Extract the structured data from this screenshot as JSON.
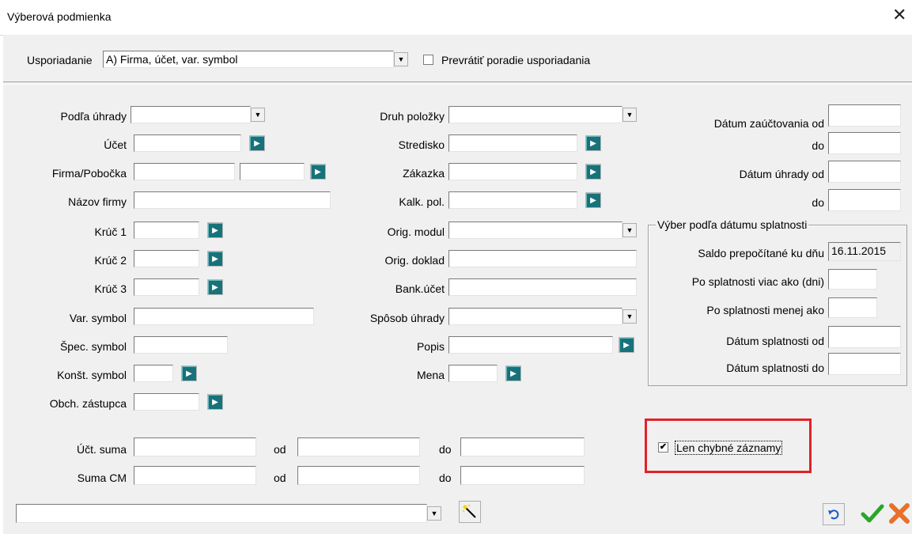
{
  "window": {
    "title": "Výberová podmienka",
    "close": "✕"
  },
  "sort": {
    "label": "Usporiadanie",
    "value": "A) Firma, účet, var. symbol",
    "reverse_label": "Prevrátiť poradie usporiadania",
    "reverse_checked": false
  },
  "left": {
    "podla_uhrady": "Podľa úhrady",
    "ucet": "Účet",
    "firma": "Firma/Pobočka",
    "nazov": "Názov firmy",
    "kluc1": "Krúč 1",
    "kluc2": "Krúč 2",
    "kluc3": "Krúč 3",
    "var_symbol": "Var. symbol",
    "spec_symbol": "Špec. symbol",
    "konst_symbol": "Konšt. symbol",
    "obch_zastupca": "Obch. zástupca"
  },
  "middle": {
    "druh": "Druh položky",
    "stredisko": "Stredisko",
    "zakazka": "Zákazka",
    "kalk": "Kalk. pol.",
    "orig_modul": "Orig. modul",
    "orig_doklad": "Orig. doklad",
    "bank": "Bank.účet",
    "sposob": "Spôsob úhrady",
    "popis": "Popis",
    "mena": "Mena"
  },
  "right": {
    "datum_zauct_od": "Dátum zaúčtovania od",
    "do1": "do",
    "datum_uhrady_od": "Dátum úhrady od",
    "do2": "do",
    "group_title": "Výber podľa dátumu splatnosti",
    "saldo": "Saldo prepočítané ku dňu",
    "saldo_value": "16.11.2015",
    "po_viac": "Po splatnosti viac ako (dni)",
    "po_menej": "Po splatnosti menej ako",
    "dat_spl_od": "Dátum splatnosti od",
    "dat_spl_do": "Dátum splatnosti do"
  },
  "amounts": {
    "uct_suma": "Účt. suma",
    "suma_cm": "Suma CM",
    "od": "od",
    "do": "do"
  },
  "errors_only": {
    "label": "Len chybné záznamy",
    "checked": true,
    "mark": "✔"
  },
  "icons": {
    "dropdown": "▼",
    "go": "▶",
    "wand": "╲",
    "undo": "↶",
    "ok": "✔",
    "cancel": "✖"
  },
  "colors": {
    "go_button": "#17727a",
    "highlight_box": "#e02228",
    "ok": "#2aa52a",
    "cancel": "#e8702a"
  }
}
